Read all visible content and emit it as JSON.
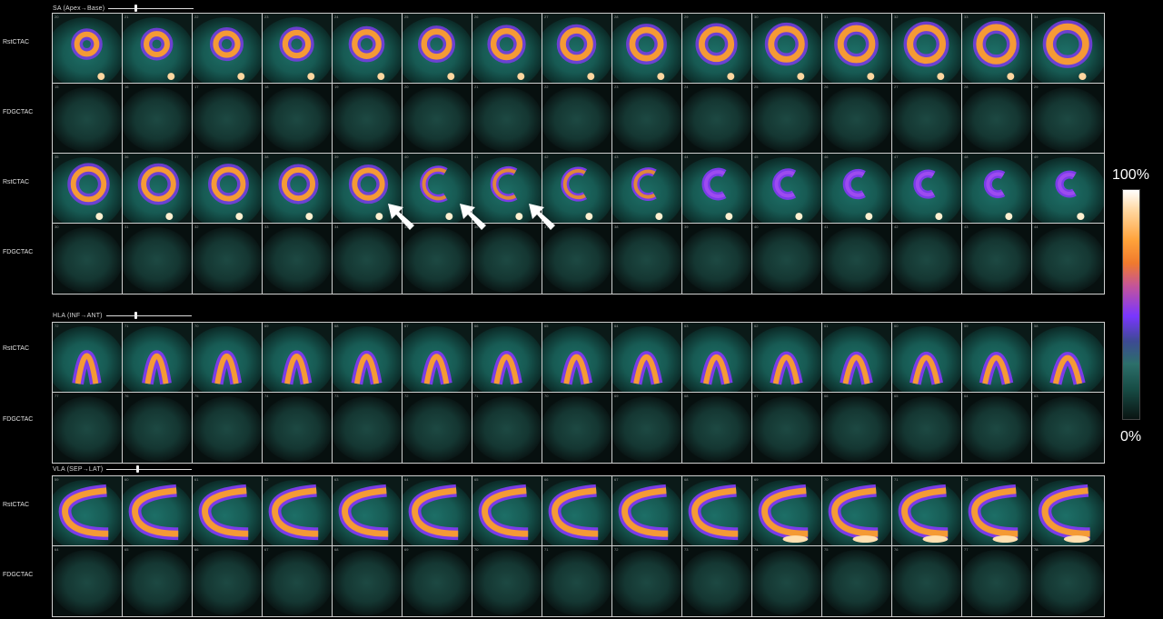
{
  "colorbar": {
    "max_label": "100%",
    "min_label": "0%"
  },
  "rows": {
    "rest": "RstCTAC",
    "fdg": "FDGCTAC"
  },
  "icons": {
    "arrow": "arrow-up-left-icon"
  },
  "sections": [
    {
      "id": "sa",
      "title": "SA (Apex→Base)",
      "slider_fraction": 0.31,
      "numbers": [
        [
          "20",
          "21",
          "22",
          "23",
          "24",
          "25",
          "26",
          "27",
          "28",
          "29",
          "30",
          "31",
          "32",
          "33",
          "34"
        ],
        [
          "15",
          "16",
          "17",
          "18",
          "19",
          "20",
          "21",
          "22",
          "23",
          "24",
          "25",
          "26",
          "27",
          "28",
          "29"
        ],
        [
          "35",
          "36",
          "37",
          "38",
          "39",
          "40",
          "41",
          "42",
          "43",
          "44",
          "45",
          "46",
          "47",
          "48",
          "49"
        ],
        [
          "30",
          "31",
          "32",
          "33",
          "34",
          "35",
          "36",
          "37",
          "38",
          "39",
          "40",
          "41",
          "42",
          "43",
          "44"
        ]
      ]
    },
    {
      "id": "hla",
      "title": "HLA (INF→ANT)",
      "slider_fraction": 0.33,
      "numbers": [
        [
          "72",
          "71",
          "70",
          "69",
          "68",
          "67",
          "66",
          "65",
          "64",
          "63",
          "62",
          "61",
          "60",
          "59",
          "58"
        ],
        [
          "77",
          "76",
          "75",
          "74",
          "73",
          "72",
          "71",
          "70",
          "69",
          "68",
          "67",
          "66",
          "65",
          "64",
          "63"
        ]
      ]
    },
    {
      "id": "vla",
      "title": "VLA (SEP→LAT)",
      "slider_fraction": 0.35,
      "numbers": [
        [
          "59",
          "60",
          "61",
          "62",
          "63",
          "64",
          "65",
          "66",
          "67",
          "68",
          "69",
          "70",
          "71",
          "72",
          "73"
        ],
        [
          "64",
          "65",
          "66",
          "67",
          "68",
          "69",
          "70",
          "71",
          "72",
          "73",
          "74",
          "75",
          "76",
          "77",
          "78"
        ]
      ]
    }
  ]
}
